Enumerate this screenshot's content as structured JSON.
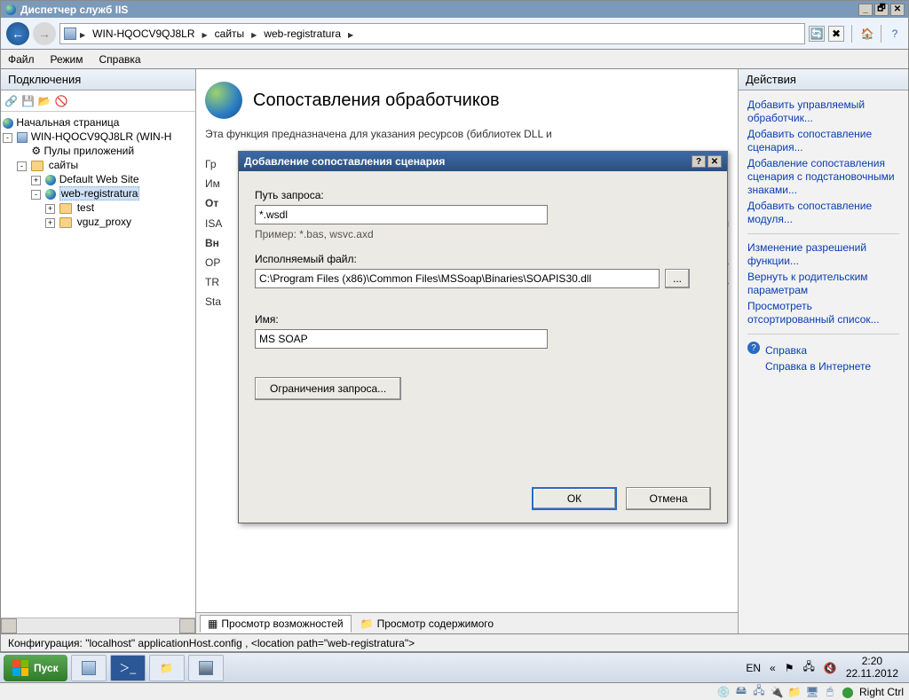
{
  "window": {
    "title": "Диспетчер служб IIS"
  },
  "breadcrumb": {
    "host": "WIN-HQOCV9QJ8LR",
    "sites": "сайты",
    "site": "web-registratura"
  },
  "menu": {
    "file": "Файл",
    "mode": "Режим",
    "help": "Справка"
  },
  "panels": {
    "connections": "Подключения",
    "actions": "Действия"
  },
  "tree": {
    "start_page": "Начальная страница",
    "server": "WIN-HQOCV9QJ8LR (WIN-H",
    "app_pools": "Пулы приложений",
    "sites": "сайты",
    "default_site": "Default Web Site",
    "web_reg": "web-registratura",
    "test": "test",
    "vguz": "vguz_proxy"
  },
  "feature": {
    "title": "Сопоставления обработчиков",
    "desc": "Эта функция предназначена для указания ресурсов (библиотек DLL и",
    "tab_features": "Просмотр возможностей",
    "tab_content": "Просмотр содержимого",
    "bg_lines": {
      "l1": "Гр",
      "l2": "Им",
      "l3": "От",
      "l4": "ISA",
      "l5": "Вн",
      "l6": "OP",
      "l7": "TR",
      "l8": "Sta",
      "r1": "du",
      "r2": "olS",
      "r3": "olS",
      "r4": "leM"
    }
  },
  "actions": {
    "a1": "Добавить управляемый обработчик...",
    "a2": "Добавить сопоставление сценария...",
    "a3": "Добавление сопоставления сценария с подстановочными знаками...",
    "a4": "Добавить сопоставление модуля...",
    "a5": "Изменение разрешений функции...",
    "a6": "Вернуть к родительским параметрам",
    "a7": "Просмотреть отсортированный список...",
    "help": "Справка",
    "help_online": "Справка в Интернете"
  },
  "dialog": {
    "title": "Добавление сопоставления сценария",
    "path_label": "Путь запроса:",
    "path_value": "*.wsdl",
    "path_hint": "Пример: *.bas, wsvc.axd",
    "exe_label": "Исполняемый файл:",
    "exe_value": "C:\\Program Files (x86)\\Common Files\\MSSoap\\Binaries\\SOAPIS30.dll",
    "browse": "...",
    "name_label": "Имя:",
    "name_value": "MS SOAP",
    "restrictions": "Ограничения запроса...",
    "ok": "ОК",
    "cancel": "Отмена"
  },
  "status": {
    "config": "Конфигурация: \"localhost\" applicationHost.config , <location path=\"web-registratura\">"
  },
  "taskbar": {
    "start": "Пуск",
    "lang": "EN",
    "time": "2:20",
    "date": "22.11.2012"
  },
  "vm": {
    "rctrl": "Right Ctrl"
  }
}
